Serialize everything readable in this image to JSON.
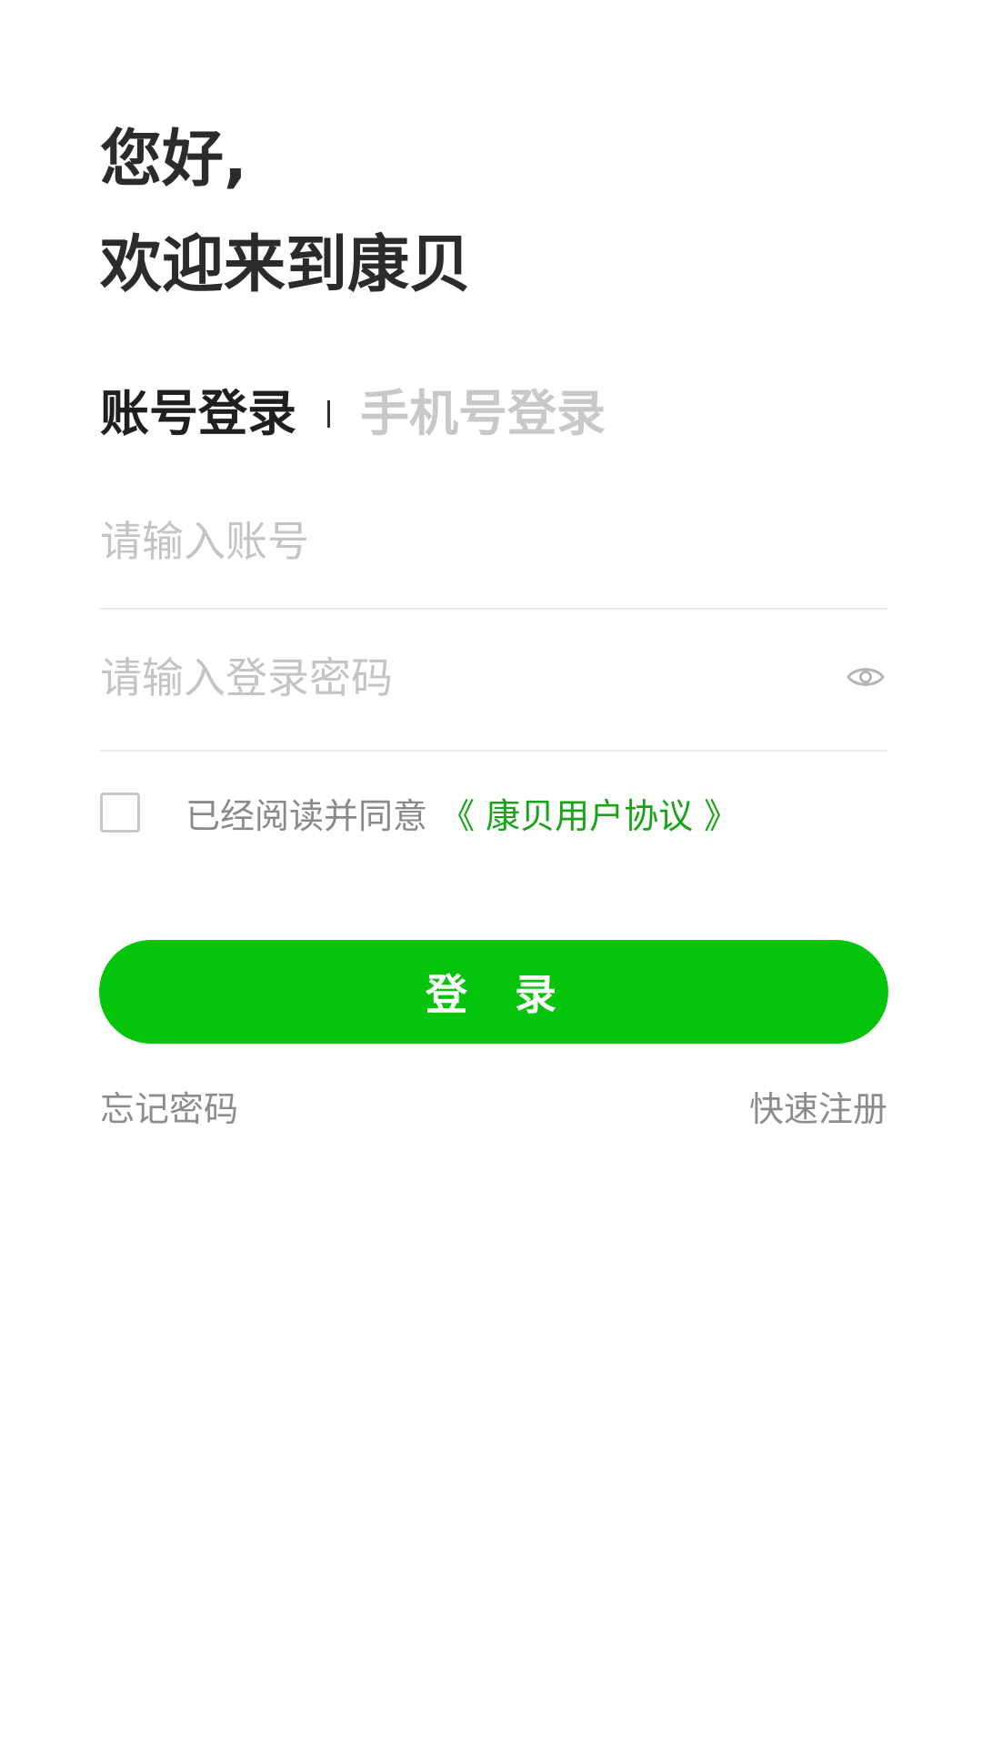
{
  "header": {
    "greeting_line1": "您好,",
    "greeting_line2": "欢迎来到康贝"
  },
  "tabs": [
    {
      "label": "账号登录",
      "active": true
    },
    {
      "label": "手机号登录",
      "active": false
    }
  ],
  "form": {
    "account_placeholder": "请输入账号",
    "password_placeholder": "请输入登录密码",
    "password_toggle_icon": "eye-icon"
  },
  "agreement": {
    "checked": false,
    "text": "已经阅读并同意",
    "link": "《 康贝用户协议 》"
  },
  "login_button": "登 录",
  "links": {
    "forgot_password": "忘记密码",
    "quick_register": "快速注册"
  },
  "colors": {
    "accent": "#06c40c",
    "link": "#19a319",
    "text_dark": "#2b2b2b",
    "text_muted": "#8c8c8c",
    "placeholder": "#c4c4c4"
  }
}
